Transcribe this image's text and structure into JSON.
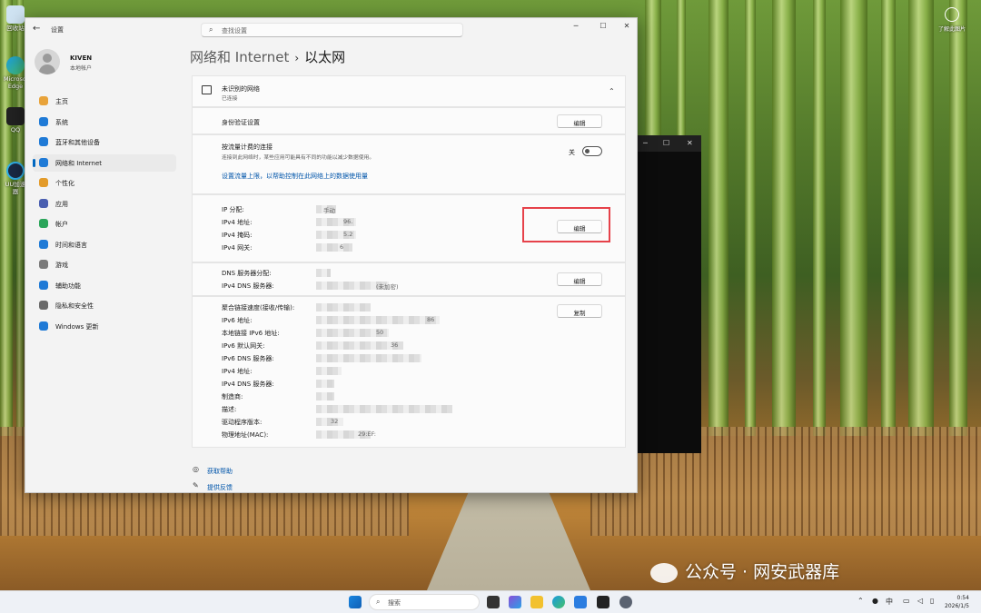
{
  "window": {
    "app_title": "设置",
    "search_placeholder": "查找设置",
    "controls": {
      "minimize": "─",
      "maximize": "☐",
      "close": "✕"
    }
  },
  "profile": {
    "name": "KIVEN",
    "type": "本地帐户"
  },
  "sidebar": {
    "items": [
      {
        "label": "主页",
        "icon": "home-icon",
        "color": "#e8a33a"
      },
      {
        "label": "系统",
        "icon": "system-icon",
        "color": "#1f7ad6"
      },
      {
        "label": "蓝牙和其他设备",
        "icon": "bluetooth-icon",
        "color": "#1f7ad6"
      },
      {
        "label": "网络和 Internet",
        "icon": "network-icon",
        "color": "#1f7ad6",
        "selected": true
      },
      {
        "label": "个性化",
        "icon": "personalization-icon",
        "color": "#e39b2a"
      },
      {
        "label": "应用",
        "icon": "apps-icon",
        "color": "#4a5fb0"
      },
      {
        "label": "帐户",
        "icon": "account-icon",
        "color": "#2aa55a"
      },
      {
        "label": "时间和语言",
        "icon": "time-language-icon",
        "color": "#1f7ad6"
      },
      {
        "label": "游戏",
        "icon": "gaming-icon",
        "color": "#7a7a7a"
      },
      {
        "label": "辅助功能",
        "icon": "accessibility-icon",
        "color": "#1f7ad6"
      },
      {
        "label": "隐私和安全性",
        "icon": "privacy-icon",
        "color": "#6a6a6a"
      },
      {
        "label": "Windows 更新",
        "icon": "windows-update-icon",
        "color": "#1f7ad6"
      }
    ]
  },
  "breadcrumb": {
    "parent": "网络和 Internet",
    "separator": "›",
    "current": "以太网"
  },
  "network": {
    "name": "未识别的网络",
    "status": "已连接",
    "expand": "⌃"
  },
  "auth": {
    "label": "身份验证设置",
    "button": "编辑"
  },
  "metered": {
    "label": "按流量计费的连接",
    "description": "连接到此网络时，某些应用可能具有不同的功能以减少数据使用。",
    "state": "关",
    "link": "设置流量上限，以帮助控制在此网络上的数据使用量"
  },
  "ip": {
    "labels": [
      "IP 分配:",
      "IPv4 地址:",
      "IPv4 掩码:",
      "IPv4 网关:"
    ],
    "values": [
      "手动",
      "96.",
      "5.2",
      "6"
    ],
    "button": "编辑"
  },
  "dns": {
    "labels": [
      "DNS 服务器分配:",
      "IPv4 DNS 服务器:"
    ],
    "values": [
      "",
      "(未加密)"
    ],
    "button": "编辑"
  },
  "props": {
    "labels": [
      "聚合链接速度(接收/传输):",
      "IPv6 地址:",
      "本地链接 IPv6 地址:",
      "IPv6 默认网关:",
      "IPv6 DNS 服务器:",
      "IPv4 地址:",
      "IPv4 DNS 服务器:",
      "制造商:",
      "描述:",
      "驱动程序版本:",
      "物理地址(MAC):"
    ],
    "values": [
      "",
      "86",
      "50",
      "36",
      "",
      "",
      "",
      "",
      "",
      "32",
      "29:EF:"
    ],
    "button": "复制"
  },
  "footer": {
    "help": "获取帮助",
    "feedback": "提供反馈"
  },
  "desktop": {
    "icons": [
      "回收站",
      "Microsoft Edge",
      "QQ",
      "UU加速器"
    ],
    "top_right": "了解此图片"
  },
  "watermark": "公众号 · 网安武器库",
  "taskbar": {
    "search": "搜索",
    "ime": "中",
    "time": "0:54",
    "date": "2026/1/5"
  }
}
